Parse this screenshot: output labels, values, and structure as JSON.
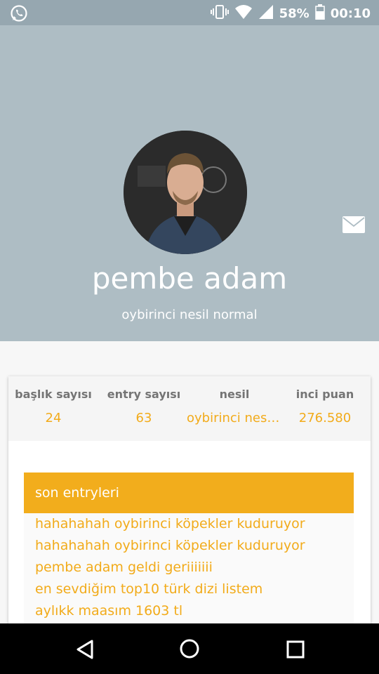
{
  "status_bar": {
    "battery": "58%",
    "time": "00:10",
    "icons": [
      "whatsapp-icon",
      "vibrate-icon",
      "wifi-icon",
      "signal-icon",
      "battery-icon"
    ]
  },
  "profile": {
    "name": "pembe adam",
    "subtitle": "oybirinci nesil normal",
    "avatar": "avatar-photo",
    "message_icon": "mail-icon"
  },
  "stats": [
    {
      "label": "başlık sayısı",
      "value": "24"
    },
    {
      "label": "entry sayısı",
      "value": "63"
    },
    {
      "label": "nesil",
      "value": "oybirinci nesi..."
    },
    {
      "label": "inci puan",
      "value": "276.580"
    }
  ],
  "entries": {
    "title": "son entryleri",
    "items": [
      "hahahahah oybirinci köpekler kuduruyor",
      "hahahahah oybirinci köpekler kuduruyor",
      "pembe adam geldi geriiiiiii",
      "en sevdiğim top10 türk dizi listem",
      "aylıkk maasım 1603 tl"
    ]
  },
  "colors": {
    "accent": "#f2ad1c",
    "header_bg": "#aebdc4",
    "statusbar_bg": "#96a7b0"
  },
  "nav": {
    "icons": [
      "back-icon",
      "home-icon",
      "recents-icon"
    ]
  }
}
